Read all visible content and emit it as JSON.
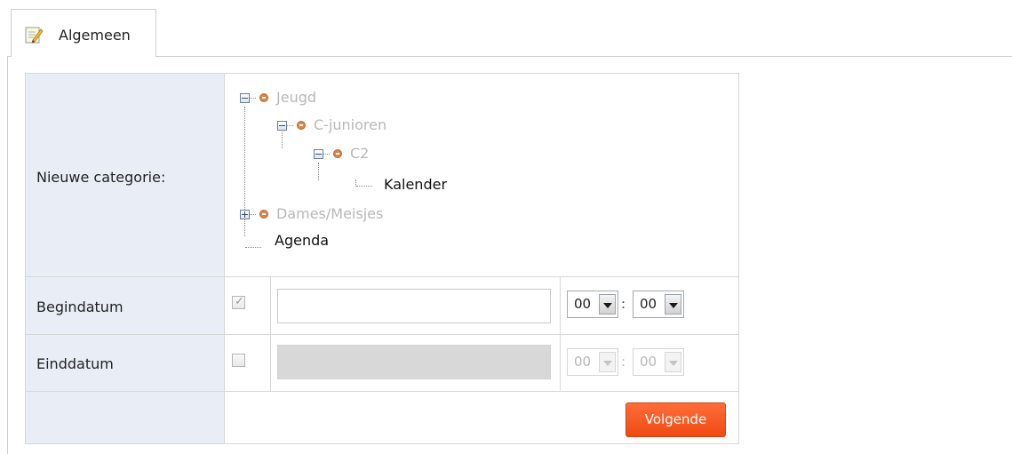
{
  "tabs": [
    {
      "label": "Algemeen",
      "icon": "edit-document-icon"
    }
  ],
  "form": {
    "category_label": "Nieuwe categorie:",
    "tree": {
      "jeugd": "Jeugd",
      "c_junioren": "C-junioren",
      "c2": "C2",
      "kalender": "Kalender",
      "dames": "Dames/Meisjes",
      "agenda": "Agenda"
    },
    "begin": {
      "label": "Begindatum",
      "checked": true,
      "date_value": "",
      "hour": "00",
      "minute": "00",
      "separator": ":"
    },
    "end": {
      "label": "Einddatum",
      "checked": false,
      "date_value": "",
      "hour": "00",
      "minute": "00",
      "separator": ":"
    },
    "next_button": "Volgende"
  },
  "colors": {
    "label_cell_bg": "#e9eef6",
    "accent_button": "#f25418",
    "disabled_text": "#b8b8b8",
    "tree_dot": "#d8864a"
  }
}
